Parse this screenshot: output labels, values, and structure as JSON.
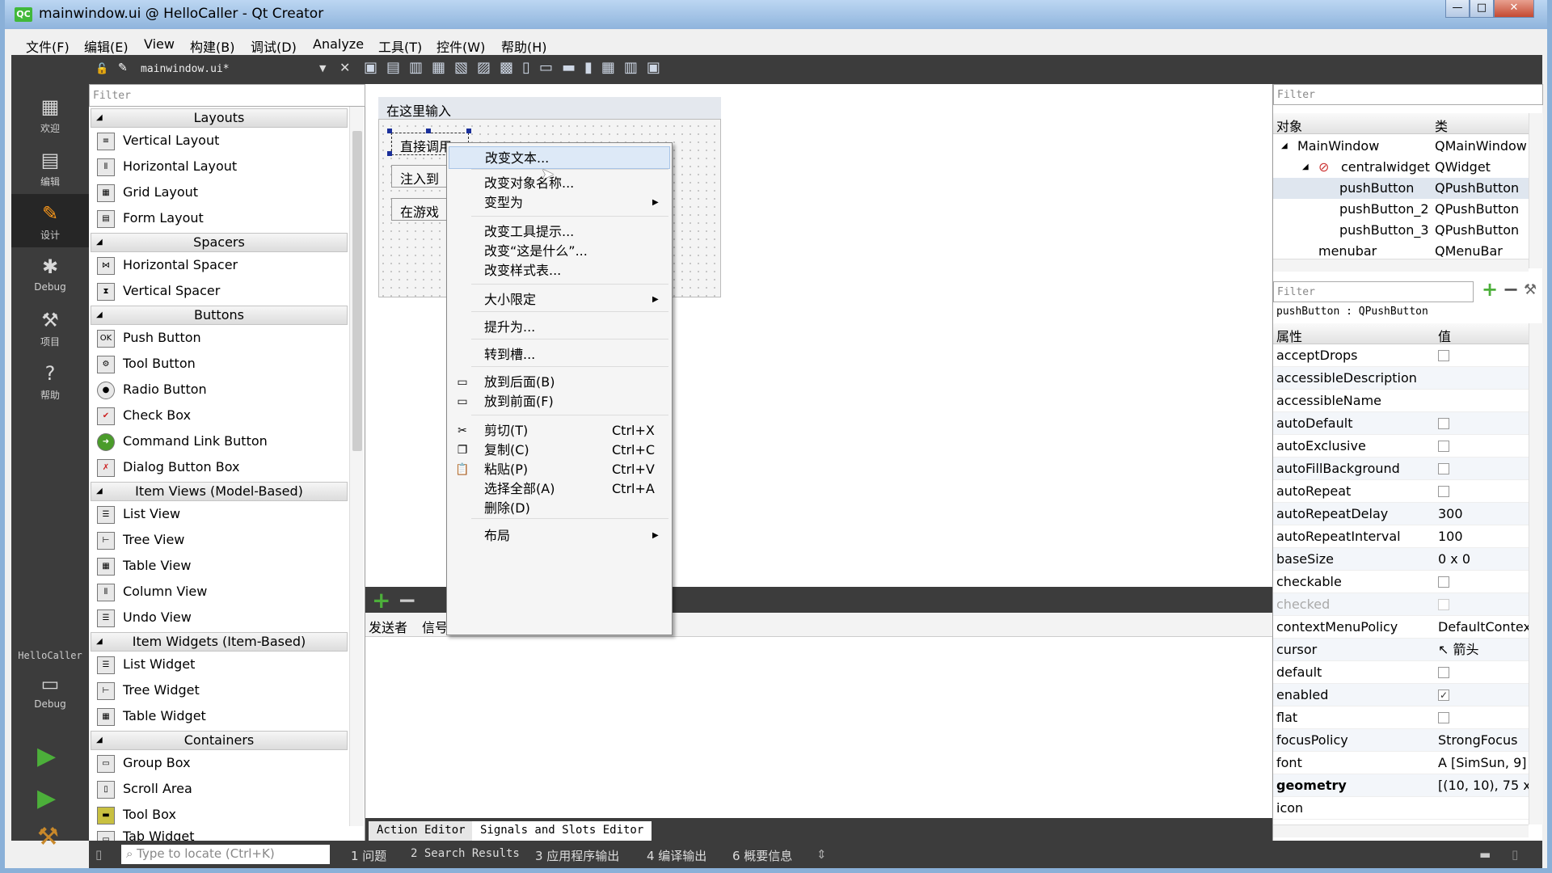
{
  "window": {
    "title": "mainwindow.ui @ HelloCaller - Qt Creator",
    "icon": "QC",
    "min": "—",
    "max": "□",
    "close": "✕"
  },
  "menubar": [
    "文件(F)",
    "编辑(E)",
    "View",
    "构建(B)",
    "调试(D)",
    "Analyze",
    "工具(T)",
    "控件(W)",
    "帮助(H)"
  ],
  "modes": [
    {
      "label": "欢迎",
      "icon": "grid-icon"
    },
    {
      "label": "编辑",
      "icon": "document-icon"
    },
    {
      "label": "设计",
      "icon": "pencil-icon"
    },
    {
      "label": "Debug",
      "icon": "bug-icon"
    },
    {
      "label": "项目",
      "icon": "wrench-icon"
    },
    {
      "label": "帮助",
      "icon": "help-icon"
    }
  ],
  "kit": {
    "project": "HelloCaller",
    "mode": "Debug"
  },
  "doc": {
    "filename": "mainwindow.ui*"
  },
  "widgetbox": {
    "filter": "Filter",
    "cats": [
      {
        "name": "Layouts",
        "items": [
          "Vertical Layout",
          "Horizontal Layout",
          "Grid Layout",
          "Form Layout"
        ]
      },
      {
        "name": "Spacers",
        "items": [
          "Horizontal Spacer",
          "Vertical Spacer"
        ]
      },
      {
        "name": "Buttons",
        "items": [
          "Push Button",
          "Tool Button",
          "Radio Button",
          "Check Box",
          "Command Link Button",
          "Dialog Button Box"
        ]
      },
      {
        "name": "Item Views (Model-Based)",
        "items": [
          "List View",
          "Tree View",
          "Table View",
          "Column View",
          "Undo View"
        ]
      },
      {
        "name": "Item Widgets (Item-Based)",
        "items": [
          "List Widget",
          "Tree Widget",
          "Table Widget"
        ]
      },
      {
        "name": "Containers",
        "items": [
          "Group Box",
          "Scroll Area",
          "Tool Box",
          "Tab Widget"
        ]
      }
    ]
  },
  "form": {
    "menu_placeholder": "在这里输入",
    "buttons": [
      "直接调用",
      "注入到游",
      "在游戏中"
    ]
  },
  "context_menu": [
    {
      "label": "改变文本...",
      "hl": true
    },
    {
      "label": "改变对象名称..."
    },
    {
      "label": "变型为",
      "sub": true
    },
    {
      "label": "改变工具提示..."
    },
    {
      "label": "改变“这是什么”..."
    },
    {
      "label": "改变样式表..."
    },
    {
      "label": "大小限定",
      "sub": true
    },
    {
      "label": "提升为..."
    },
    {
      "label": "转到槽..."
    },
    {
      "label": "放到后面(B)"
    },
    {
      "label": "放到前面(F)"
    },
    {
      "label": "剪切(T)",
      "shortcut": "Ctrl+X"
    },
    {
      "label": "复制(C)",
      "shortcut": "Ctrl+C"
    },
    {
      "label": "粘贴(P)",
      "shortcut": "Ctrl+V"
    },
    {
      "label": "选择全部(A)",
      "shortcut": "Ctrl+A"
    },
    {
      "label": "删除(D)"
    },
    {
      "label": "布局",
      "sub": true
    }
  ],
  "signals": {
    "col_sender": "发送者",
    "col_signal": "信号"
  },
  "bottom_tabs": [
    "Action Editor",
    "Signals and Slots Editor"
  ],
  "status": {
    "locate": "Type to locate (Ctrl+K)",
    "panes": [
      "1 问题",
      "2 Search Results",
      "3 应用程序输出",
      "4 编译输出",
      "6 概要信息"
    ]
  },
  "objects": {
    "filter": "Filter",
    "col_obj": "对象",
    "col_cls": "类",
    "rows": [
      {
        "name": "MainWindow",
        "cls": "QMainWindow"
      },
      {
        "name": "centralwidget",
        "cls": "QWidget"
      },
      {
        "name": "pushButton",
        "cls": "QPushButton"
      },
      {
        "name": "pushButton_2",
        "cls": "QPushButton"
      },
      {
        "name": "pushButton_3",
        "cls": "QPushButton"
      },
      {
        "name": "menubar",
        "cls": "QMenuBar"
      }
    ]
  },
  "props": {
    "filter": "Filter",
    "selection": "pushButton : QPushButton",
    "col_prop": "属性",
    "col_val": "值",
    "rows": [
      {
        "name": "acceptDrops",
        "value": "",
        "cb": "off"
      },
      {
        "name": "accessibleDescription",
        "value": ""
      },
      {
        "name": "accessibleName",
        "value": ""
      },
      {
        "name": "autoDefault",
        "value": "",
        "cb": "off"
      },
      {
        "name": "autoExclusive",
        "value": "",
        "cb": "off"
      },
      {
        "name": "autoFillBackground",
        "value": "",
        "cb": "off"
      },
      {
        "name": "autoRepeat",
        "value": "",
        "cb": "off"
      },
      {
        "name": "autoRepeatDelay",
        "value": "300"
      },
      {
        "name": "autoRepeatInterval",
        "value": "100"
      },
      {
        "name": "baseSize",
        "value": "0 x 0"
      },
      {
        "name": "checkable",
        "value": "",
        "cb": "off"
      },
      {
        "name": "checked",
        "value": "",
        "cb": "dis"
      },
      {
        "name": "contextMenuPolicy",
        "value": "DefaultContex..."
      },
      {
        "name": "cursor",
        "value": "箭头"
      },
      {
        "name": "default",
        "value": "",
        "cb": "off"
      },
      {
        "name": "enabled",
        "value": "",
        "cb": "on"
      },
      {
        "name": "flat",
        "value": "",
        "cb": "off"
      },
      {
        "name": "focusPolicy",
        "value": "StrongFocus"
      },
      {
        "name": "font",
        "value": "[SimSun, 9]"
      },
      {
        "name": "geometry",
        "value": "[(10, 10), 75 x ..."
      },
      {
        "name": "icon",
        "value": ""
      }
    ]
  }
}
